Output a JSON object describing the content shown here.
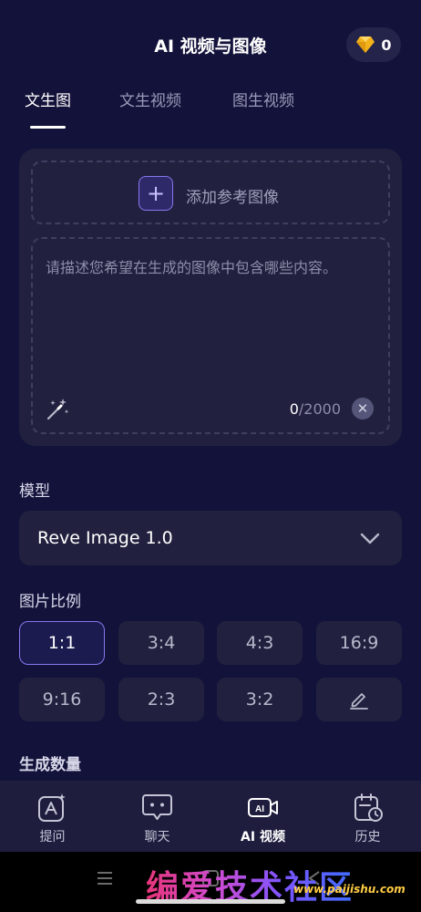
{
  "header": {
    "title": "AI 视频与图像",
    "gem_count": "0"
  },
  "tabs": [
    {
      "label": "文生图",
      "active": true
    },
    {
      "label": "文生视频",
      "active": false
    },
    {
      "label": "图生视频",
      "active": false
    }
  ],
  "reference": {
    "add_label": "添加参考图像"
  },
  "prompt": {
    "placeholder": "请描述您希望在生成的图像中包含哪些内容。",
    "count_current": "0",
    "count_max": "/2000"
  },
  "model": {
    "section_label": "模型",
    "selected": "Reve Image 1.0"
  },
  "ratio": {
    "section_label": "图片比例",
    "options": [
      "1:1",
      "3:4",
      "4:3",
      "16:9",
      "9:16",
      "2:3",
      "3:2"
    ],
    "selected": "1:1",
    "custom_icon": "edit-pencil-icon"
  },
  "quantity": {
    "section_label": "生成数量"
  },
  "bottom_nav": [
    {
      "label": "提问",
      "icon": "ai-question-icon",
      "active": false
    },
    {
      "label": "聊天",
      "icon": "chat-bubble-icon",
      "active": false
    },
    {
      "label": "AI 视频",
      "icon": "ai-video-icon",
      "active": true
    },
    {
      "label": "历史",
      "icon": "history-calendar-icon",
      "active": false
    }
  ],
  "watermark": {
    "text": "编爱技术社区",
    "url": "www.paijishu.com"
  },
  "colors": {
    "accent": "#8877ee",
    "background": "#13123a",
    "card": "#21213f",
    "gem": "#f2b21c"
  }
}
